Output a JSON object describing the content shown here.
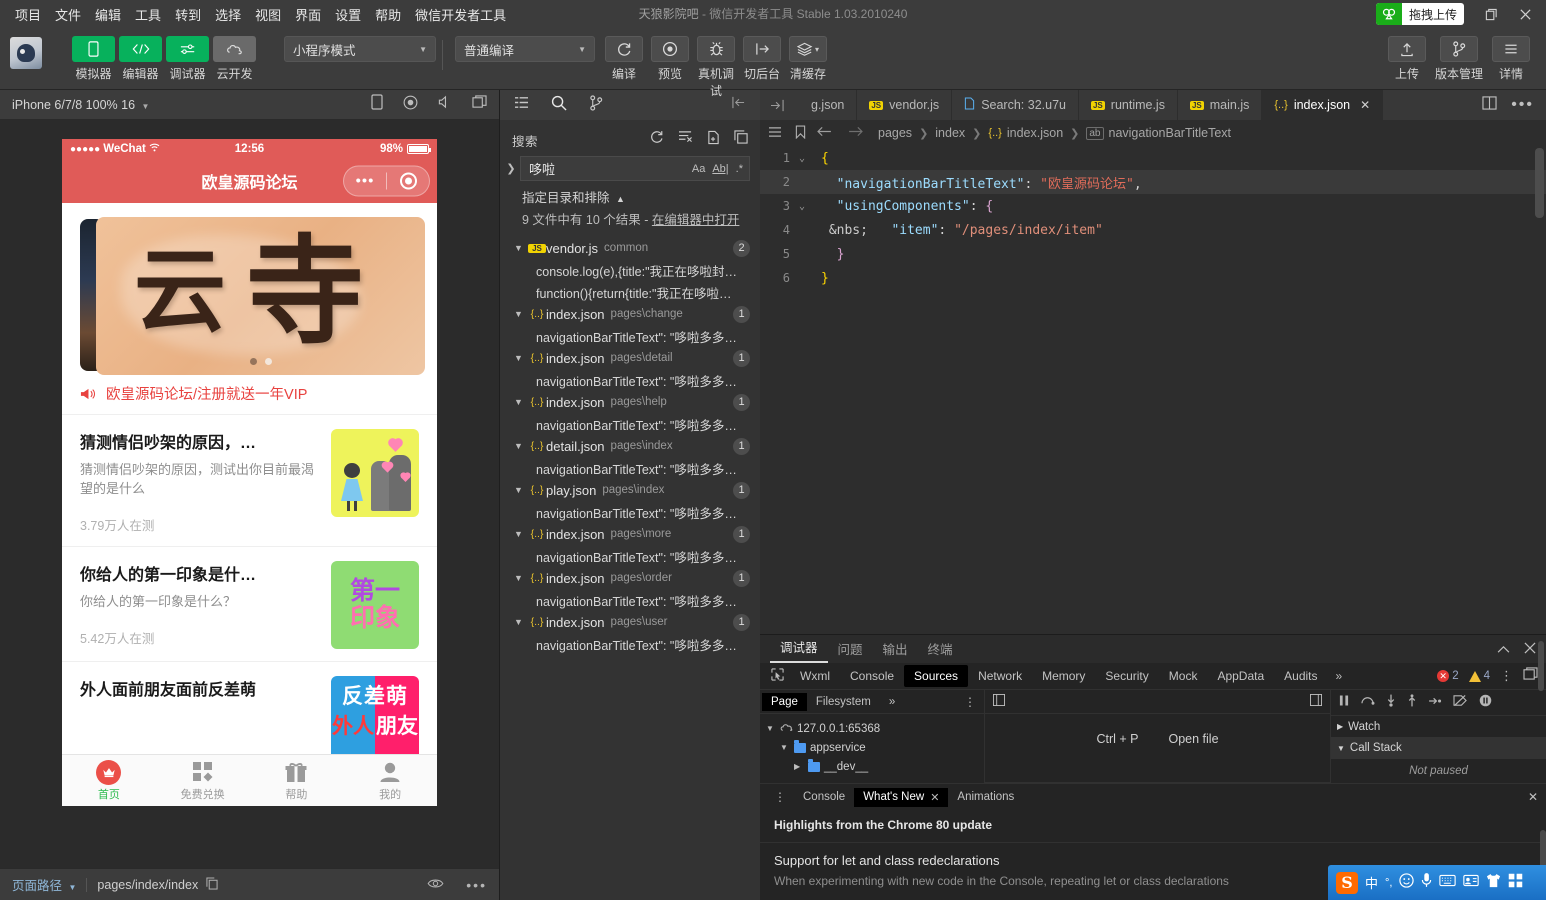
{
  "menubar": {
    "items": [
      "项目",
      "文件",
      "编辑",
      "工具",
      "转到",
      "选择",
      "视图",
      "界面",
      "设置",
      "帮助",
      "微信开发者工具"
    ],
    "window_title_project": "天狼影院吧",
    "window_title_rest": "- 微信开发者工具 Stable 1.03.2010240",
    "upload_chip_label": "拖拽上传",
    "restore_icon": "restore-icon",
    "close_icon": "close-icon"
  },
  "toolbar": {
    "left_buttons": [
      {
        "label": "模拟器",
        "icon": "phone-icon",
        "style": "green"
      },
      {
        "label": "编辑器",
        "icon": "code-icon",
        "style": "green"
      },
      {
        "label": "调试器",
        "icon": "sliders-icon",
        "style": "green"
      },
      {
        "label": "云开发",
        "icon": "cloud-icon",
        "style": "grey"
      }
    ],
    "mode_select_value": "小程序模式",
    "compile_select_value": "普通编译",
    "center_buttons": [
      {
        "label": "编译",
        "icon": "refresh-icon"
      },
      {
        "label": "预览",
        "icon": "eye-icon"
      },
      {
        "label": "真机调试",
        "icon": "bug-icon"
      },
      {
        "label": "切后台",
        "icon": "background-icon"
      },
      {
        "label": "清缓存",
        "icon": "layers-icon"
      }
    ],
    "right_buttons": [
      {
        "label": "上传",
        "icon": "upload-icon"
      },
      {
        "label": "版本管理",
        "icon": "branch-icon"
      },
      {
        "label": "详情",
        "icon": "menu-icon"
      }
    ]
  },
  "simulator": {
    "device_label": "iPhone 6/7/8 100% 16",
    "head_icons": [
      "phone-rotate-icon",
      "record-icon",
      "volume-icon",
      "multi-window-icon"
    ],
    "status_bar": {
      "carrier": "WeChat",
      "signal_dots": "●●●●●",
      "wifi_icon": "wifi-icon",
      "time": "12:56",
      "battery_percent": "98%"
    },
    "nav_title": "欧皇源码论坛",
    "banner": {
      "char1": "云",
      "char2": "寺",
      "dots": 2,
      "active_dot": 2
    },
    "notice_text": "欧皇源码论坛/注册就送一年VIP",
    "notice_icon": "megaphone-icon",
    "feed": [
      {
        "title": "猜测情侣吵架的原因，…",
        "desc": "猜测情侣吵架的原因，测试出你目前最渴望的是什么",
        "count": "3.79万人在测",
        "thumb": "couple-thumb"
      },
      {
        "title": "你给人的第一印象是什…",
        "desc": "你给人的第一印象是什么？",
        "count": "5.42万人在测",
        "thumb": "first-impression-thumb",
        "thumb_text_1": "第一",
        "thumb_text_2": "印象"
      },
      {
        "title": "外人面前朋友面前反差萌",
        "desc": "",
        "count": "",
        "thumb": "contrast-thumb",
        "thumb_text_1": "反差萌",
        "thumb_text_2": "外人",
        "thumb_text_3": "朋友"
      }
    ],
    "tabbar": [
      {
        "label": "首页",
        "icon": "crown-icon",
        "active": true
      },
      {
        "label": "免费兑换",
        "icon": "grid-icon",
        "active": false
      },
      {
        "label": "帮助",
        "icon": "gift-icon",
        "active": false
      },
      {
        "label": "我的",
        "icon": "user-icon",
        "active": false
      }
    ],
    "footer": {
      "label": "页面路径",
      "path": "pages/index/index",
      "copy_icon": "copy-icon",
      "eye_icon": "eye-icon",
      "more_icon": "more-icon"
    }
  },
  "search_panel": {
    "activity_icons": [
      "explorer-icon",
      "search-icon",
      "source-control-icon",
      "collapse-right-icon"
    ],
    "title": "搜索",
    "action_icons": [
      "refresh-icon",
      "clear-results-icon",
      "open-new-editor-icon",
      "collapse-all-icon"
    ],
    "query_value": "哆啦",
    "query_options": [
      "Aa",
      "Ab|",
      ".*"
    ],
    "include_exclude_label": "指定目录和排除",
    "result_count_text": "9 文件中有 10 个结果 - ",
    "result_count_link": "在编辑器中打开",
    "results": [
      {
        "file": "vendor.js",
        "dir": "common",
        "count": "2",
        "icon": "js",
        "lines": [
          "console.log(e),{title:\"我正在哆啦封…",
          "function(){return{title:\"我正在哆啦…"
        ]
      },
      {
        "file": "index.json",
        "dir": "pages\\change",
        "count": "1",
        "icon": "json",
        "lines": [
          "navigationBarTitleText\": \"哆啦多多…"
        ]
      },
      {
        "file": "index.json",
        "dir": "pages\\detail",
        "count": "1",
        "icon": "json",
        "lines": [
          "navigationBarTitleText\": \"哆啦多多…"
        ]
      },
      {
        "file": "index.json",
        "dir": "pages\\help",
        "count": "1",
        "icon": "json",
        "lines": [
          "navigationBarTitleText\": \"哆啦多多…"
        ]
      },
      {
        "file": "detail.json",
        "dir": "pages\\index",
        "count": "1",
        "icon": "json",
        "lines": [
          "navigationBarTitleText\": \"哆啦多多…"
        ]
      },
      {
        "file": "play.json",
        "dir": "pages\\index",
        "count": "1",
        "icon": "json",
        "lines": [
          "navigationBarTitleText\": \"哆啦多多…"
        ]
      },
      {
        "file": "index.json",
        "dir": "pages\\more",
        "count": "1",
        "icon": "json",
        "lines": [
          "navigationBarTitleText\": \"哆啦多多…"
        ]
      },
      {
        "file": "index.json",
        "dir": "pages\\order",
        "count": "1",
        "icon": "json",
        "lines": [
          "navigationBarTitleText\": \"哆啦多多…"
        ]
      },
      {
        "file": "index.json",
        "dir": "pages\\user",
        "count": "1",
        "icon": "json",
        "lines": [
          "navigationBarTitleText\": \"哆啦多多…"
        ]
      }
    ]
  },
  "editor": {
    "lead_icon": "split-left-icon",
    "tabs": [
      {
        "label": "g.json",
        "icon": "json",
        "active": false
      },
      {
        "label": "vendor.js",
        "icon": "js",
        "active": false
      },
      {
        "label": "Search: 32.u7u",
        "icon": "doc",
        "active": false
      },
      {
        "label": "runtime.js",
        "icon": "js",
        "active": false
      },
      {
        "label": "main.js",
        "icon": "js",
        "active": false
      },
      {
        "label": "index.json",
        "icon": "jsonc",
        "active": true
      }
    ],
    "tab_right_icons": [
      "split-editor-icon",
      "more-actions-icon"
    ],
    "breadcrumb_icons": [
      "outline-icon",
      "bookmark-icon"
    ],
    "breadcrumb_nav": [
      "back-arrow-icon",
      "forward-arrow-icon"
    ],
    "breadcrumb": [
      "pages",
      "index",
      "index.json",
      "navigationBarTitleText"
    ],
    "code_lines": [
      {
        "num": "1",
        "fold": "v",
        "text": "{",
        "selected": false
      },
      {
        "num": "2",
        "fold": "",
        "text": "    \"navigationBarTitleText\": \"欧皇源码论坛\",",
        "selected": true
      },
      {
        "num": "3",
        "fold": "v",
        "text": "    \"usingComponents\": {",
        "selected": false
      },
      {
        "num": "4",
        "fold": "",
        "text": "        \"item\": \"/pages/index/item\"",
        "selected": false
      },
      {
        "num": "5",
        "fold": "",
        "text": "    }",
        "selected": false
      },
      {
        "num": "6",
        "fold": "",
        "text": "}",
        "selected": false
      }
    ],
    "code_tokens": {
      "l2_key": "\"navigationBarTitleText\"",
      "l2_val": "\"欧皇源码论坛\"",
      "l3_key": "\"usingComponents\"",
      "l4_key": "\"item\"",
      "l4_val": "\"/pages/index/item\""
    }
  },
  "devtools": {
    "panel_tabs": [
      "调试器",
      "问题",
      "输出",
      "终端"
    ],
    "panel_active_tab": "调试器",
    "panel_head_icons": [
      "chevron-up-icon",
      "close-icon"
    ],
    "chrome_tabs": [
      "Wxml",
      "Console",
      "Sources",
      "Network",
      "Memory",
      "Security",
      "Mock",
      "AppData",
      "Audits"
    ],
    "chrome_active_tab": "Sources",
    "chrome_more": "»",
    "error_count": "2",
    "warning_count": "4",
    "inspect_icon": "inspect-icon",
    "vertical_dots_icon": "more-vertical-icon",
    "dock_icon": "dock-icon",
    "sources": {
      "left_tabs": [
        "Page",
        "Filesystem"
      ],
      "left_active_tab": "Page",
      "left_more": "»",
      "tree": [
        {
          "label": "127.0.0.1:65368",
          "depth": 0,
          "icon": "cloud-icon",
          "expanded": true
        },
        {
          "label": "appservice",
          "depth": 1,
          "icon": "folder-icon",
          "expanded": true
        },
        {
          "label": "__dev__",
          "depth": 2,
          "icon": "folder-icon",
          "expanded": false
        }
      ],
      "empty_hint_key": "Ctrl + P",
      "empty_hint_text": "Open file",
      "debugger_icons": [
        "pause-icon",
        "step-over-icon",
        "step-into-icon",
        "step-out-icon",
        "step-icon",
        "deactivate-breakpoints-icon",
        "pause-exceptions-icon"
      ],
      "sections": [
        {
          "label": "Watch",
          "expanded": false
        },
        {
          "label": "Call Stack",
          "expanded": true
        }
      ],
      "call_stack_note": "Not paused"
    },
    "drawer": {
      "tabs": [
        "Console",
        "What's New",
        "Animations"
      ],
      "active_tab": "What's New",
      "whats_new_title": "Highlights from the Chrome 80 update",
      "item_title": "Support for let and class redeclarations",
      "item_desc": "When experimenting with new code in the Console, repeating let or class declarations"
    }
  },
  "ime": {
    "logo": "S",
    "items": [
      "中",
      "°,",
      "smiley-icon",
      "mic-icon",
      "keyboard-icon",
      "card-icon",
      "shirt-icon",
      "apps-icon"
    ]
  },
  "colors": {
    "accent_green": "#07b15c",
    "wechat_red": "#e05b58",
    "notice_red": "#e8423f",
    "tab_active_green": "#2dbb4e"
  }
}
